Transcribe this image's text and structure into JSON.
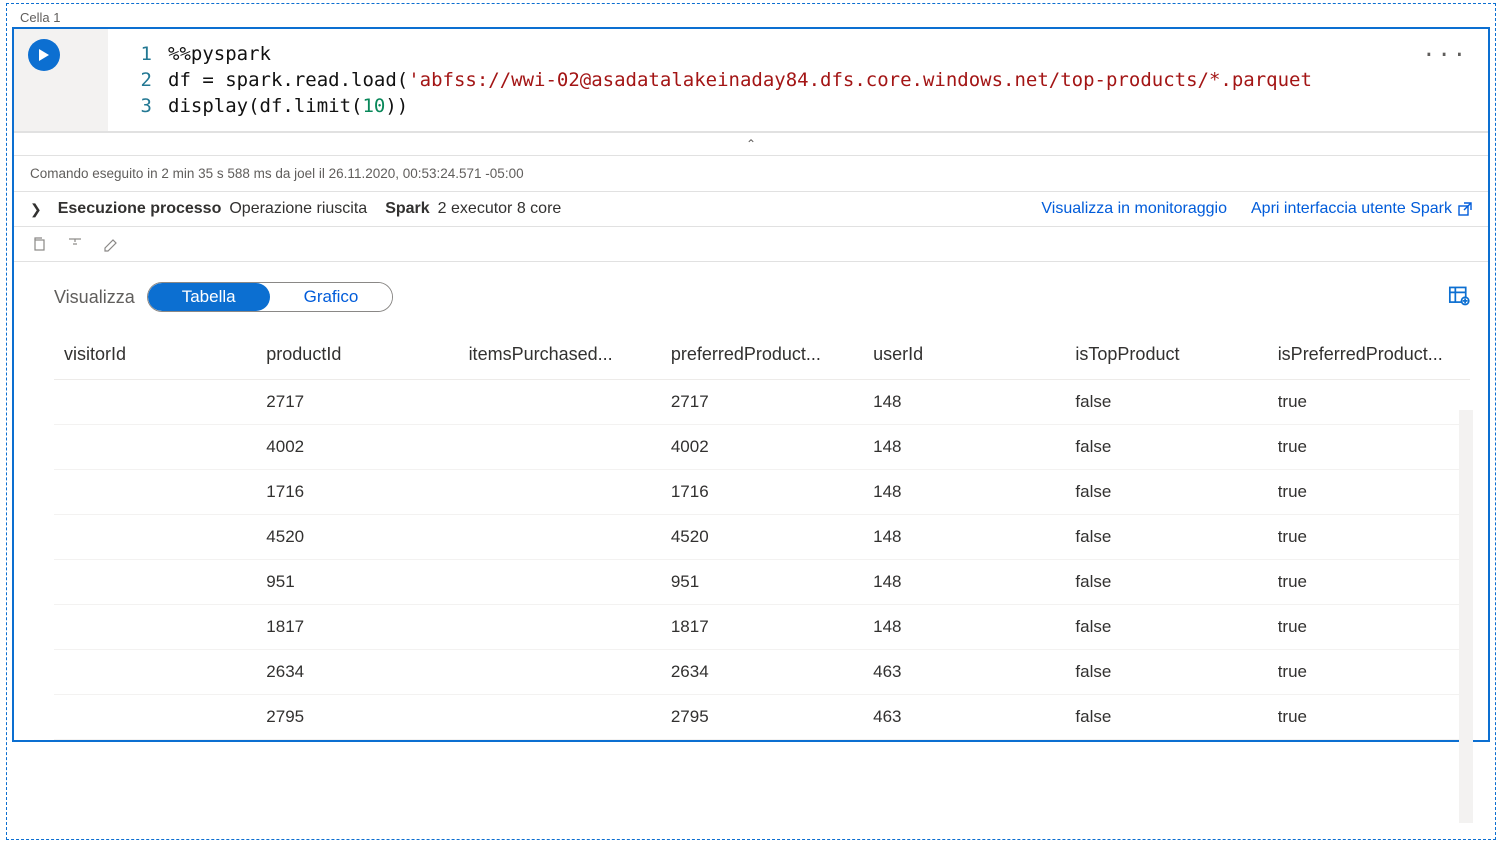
{
  "cell": {
    "header": "Cella 1",
    "lineNumbers": [
      "1",
      "2",
      "3"
    ],
    "code": {
      "line1_plain": "%%pyspark",
      "line2_pre": "df = spark.read.load(",
      "line2_str": "'abfss://wwi-02@asadatalakeinaday84.dfs.core.windows.net/top-products/*.parquet",
      "line3_pre": "display(df.limit(",
      "line3_num": "10",
      "line3_post": "))"
    },
    "more": "···",
    "collapseGlyph": "⌃"
  },
  "status": "Comando eseguito in 2 min 35 s 588 ms da joel il 26.11.2020, 00:53:24.571 -05:00",
  "exec": {
    "label": "Esecuzione processo",
    "result": "Operazione riuscita",
    "sparkLabel": "Spark",
    "sparkDetail": "2 executor 8 core",
    "monitorLink": "Visualizza in monitoraggio",
    "sparkUiLink": "Apri interfaccia utente Spark"
  },
  "view": {
    "label": "Visualizza",
    "tab_table": "Tabella",
    "tab_chart": "Grafico"
  },
  "table": {
    "columns": [
      "visitorId",
      "productId",
      "itemsPurchased...",
      "preferredProduct...",
      "userId",
      "isTopProduct",
      "isPreferredProduct..."
    ],
    "rows": [
      [
        "",
        "2717",
        "",
        "2717",
        "148",
        "false",
        "true"
      ],
      [
        "",
        "4002",
        "",
        "4002",
        "148",
        "false",
        "true"
      ],
      [
        "",
        "1716",
        "",
        "1716",
        "148",
        "false",
        "true"
      ],
      [
        "",
        "4520",
        "",
        "4520",
        "148",
        "false",
        "true"
      ],
      [
        "",
        "951",
        "",
        "951",
        "148",
        "false",
        "true"
      ],
      [
        "",
        "1817",
        "",
        "1817",
        "148",
        "false",
        "true"
      ],
      [
        "",
        "2634",
        "",
        "2634",
        "463",
        "false",
        "true"
      ],
      [
        "",
        "2795",
        "",
        "2795",
        "463",
        "false",
        "true"
      ]
    ]
  }
}
